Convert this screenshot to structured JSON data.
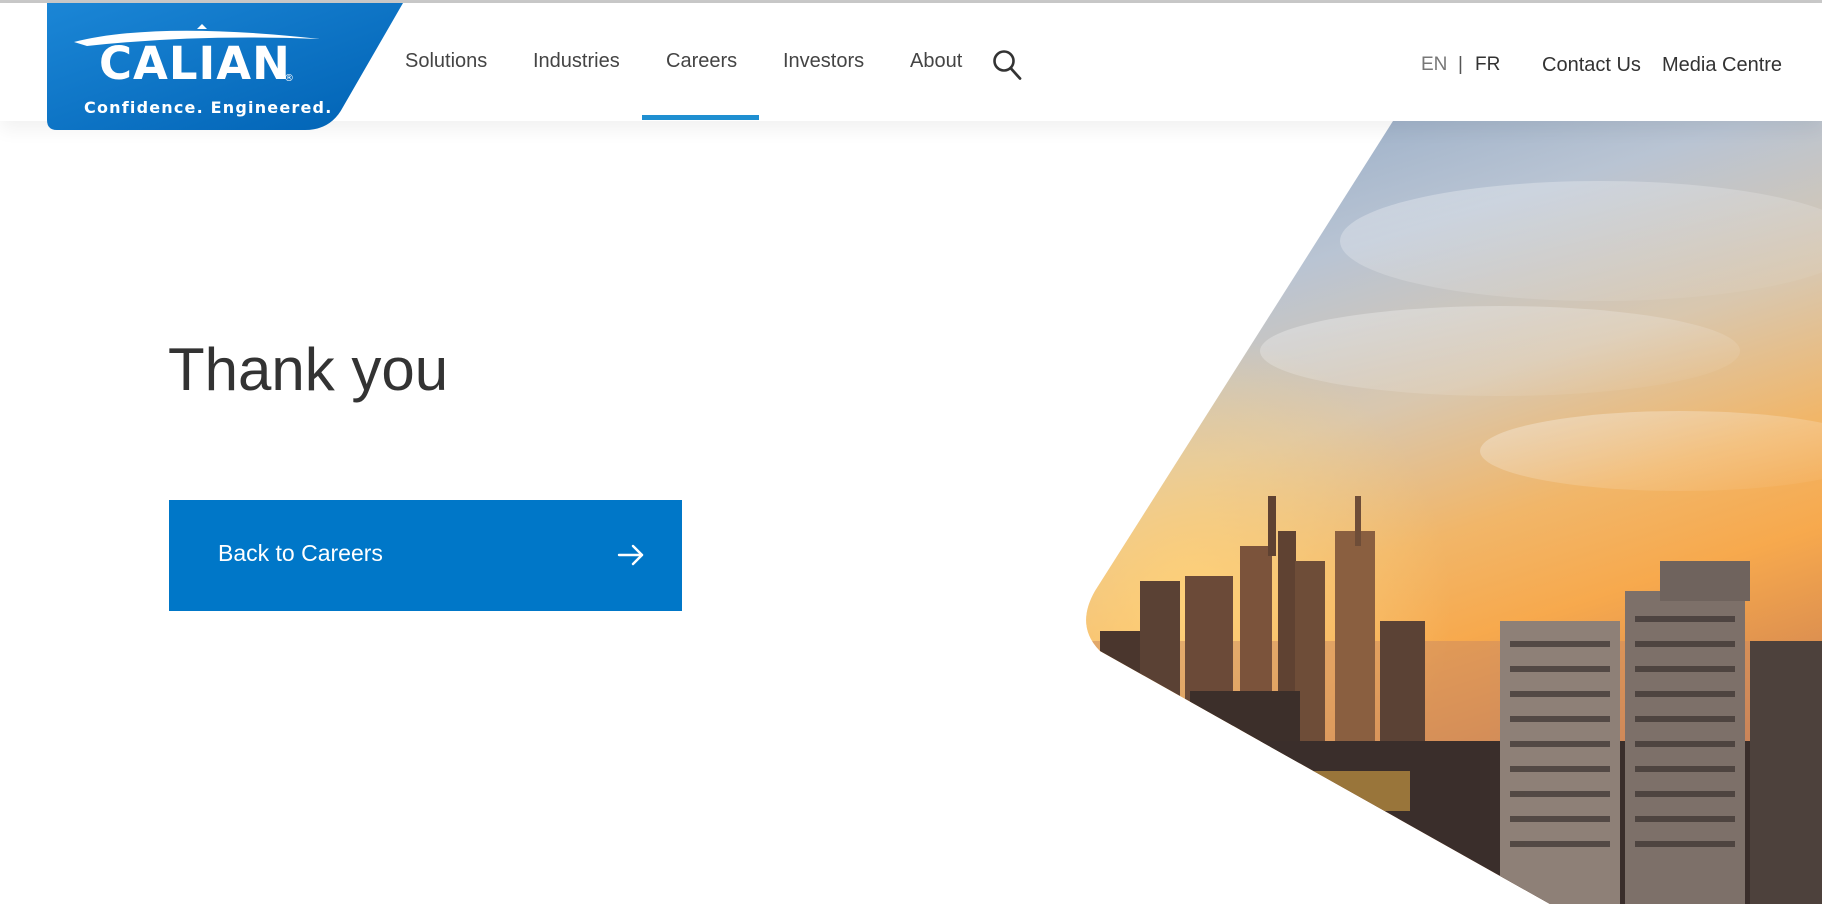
{
  "brand": {
    "name": "CALIAN",
    "registered_mark": "®",
    "tagline": "Confidence. Engineered.",
    "primary_color": "#0077c8",
    "accent_color": "#1f8fd1"
  },
  "nav": {
    "items": [
      {
        "label": "Solutions"
      },
      {
        "label": "Industries"
      },
      {
        "label": "Careers",
        "active": true
      },
      {
        "label": "Investors"
      },
      {
        "label": "About"
      }
    ],
    "search_icon": "search-icon"
  },
  "language": {
    "current": "EN",
    "separator": "|",
    "alternate": "FR"
  },
  "utility_links": {
    "contact": "Contact Us",
    "media": "Media Centre"
  },
  "hero": {
    "title": "Thank you",
    "button_label": "Back to Careers",
    "button_icon": "arrow-right-icon",
    "image": "city-skyline-sunset-image"
  }
}
